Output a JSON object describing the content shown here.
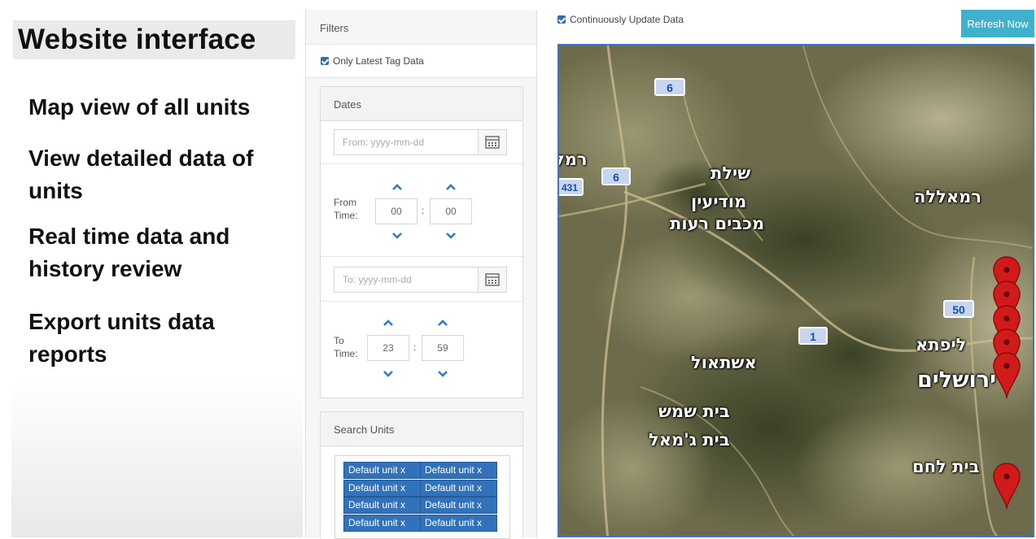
{
  "slide": {
    "title": "Website interface",
    "bullets": [
      "Map view of all units",
      "View detailed data of units",
      "Real time data and history review",
      "Export units data reports"
    ]
  },
  "filters": {
    "header": "Filters",
    "only_latest_label": "Only Latest Tag Data",
    "dates": {
      "header": "Dates",
      "from_placeholder": "From: yyyy-mm-dd",
      "from_time_label": "From Time:",
      "from_hour": "00",
      "from_minute": "00",
      "to_placeholder": "To: yyyy-mm-dd",
      "to_time_label": "To Time:",
      "to_hour": "23",
      "to_minute": "59"
    },
    "search_units": {
      "header": "Search Units",
      "tags": [
        "Default unit x",
        "Default unit x",
        "Default unit x",
        "Default unit x",
        "Default unit x",
        "Default unit x",
        "Default unit x",
        "Default unit x"
      ]
    }
  },
  "map_controls": {
    "continuous_update_label": "Continuously Update Data",
    "refresh_button": "Refresh Now"
  },
  "map": {
    "roads": [
      "6",
      "6",
      "431",
      "1",
      "50"
    ],
    "places": {
      "shilat": "שילת",
      "modiin": "מודיעין",
      "maccabim": "מכבים רעות",
      "ramallah": "רמאללה",
      "lifta": "ליפתא",
      "eshtaol": "אשתאול",
      "jerusalem": "ירושלים",
      "beit_shemesh": "בית שמש",
      "beit_jamal": "בית ג'מאל",
      "beit_lechem": "בית לחם",
      "ramla": "רמל"
    },
    "marker_color": "#d21a1a"
  }
}
